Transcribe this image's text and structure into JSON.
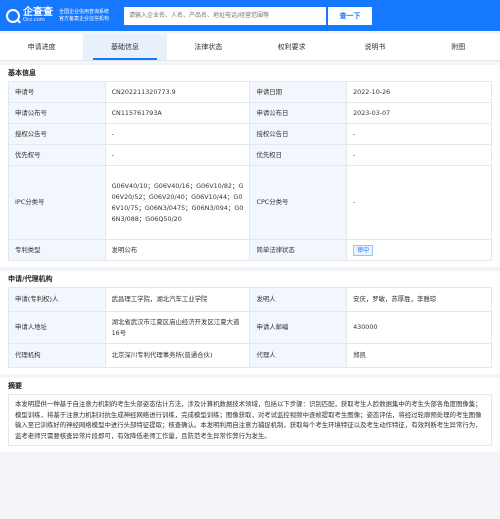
{
  "header": {
    "logo_name": "企查查",
    "logo_domain": "Qcc.com",
    "tagline_1": "全国企业信用查询系统",
    "tagline_2": "官方备案企业征信机构",
    "search_placeholder": "请输入企业名、人名、产品名、地址电话/经营范围等",
    "search_button": "查一下"
  },
  "tabs": [
    "申请进度",
    "基础信息",
    "法律状态",
    "权利要求",
    "说明书",
    "附图"
  ],
  "active_tab": 1,
  "basic": {
    "title": "基本信息",
    "rows": [
      {
        "l1": "申请号",
        "v1": "CN202211320773.9",
        "l2": "申请日期",
        "v2": "2022-10-26"
      },
      {
        "l1": "申请公布号",
        "v1": "CN115761793A",
        "l2": "申请公布日",
        "v2": "2023-03-07"
      },
      {
        "l1": "授权公告号",
        "v1": "-",
        "l2": "授权公告日",
        "v2": "-"
      },
      {
        "l1": "优先权号",
        "v1": "-",
        "l2": "优先权日",
        "v2": "-"
      },
      {
        "l1": "IPC分类号",
        "v1": "G06V40/10；G06V40/16；G06V10/82；G06V20/52；G06V20/40；G06V10/44；G06V10/75；G06N3/0475；G06N3/094；G06N3/088；G06Q50/20",
        "l2": "CPC分类号",
        "v2": "-"
      },
      {
        "l1": "专利类型",
        "v1": "发明公布",
        "l2": "简单法律状态",
        "v2": "审中"
      }
    ]
  },
  "applicant": {
    "title": "申请/代理机构",
    "applicant_label": "申请(专利权)人",
    "applicant_value": "武昌理工学院，湖北汽车工业学院",
    "inventor_label": "发明人",
    "inventor_value": "安庆，罗敏，苏厚胜，李雅琼",
    "address_label": "申请人地址",
    "address_value": "湖北省武汉市江夏区庙山经济开发区江夏大道16号",
    "postcode_label": "申请人邮编",
    "postcode_value": "430000",
    "agency_label": "代理机构",
    "agency_value": "北京深川专利代理事务所(普通合伙)",
    "agent_label": "代理人",
    "agent_value": "郑凯"
  },
  "abstract": {
    "title": "摘要",
    "text": "本发明提供一种基于自注意力机制的考生头部姿态估计方法，涉及计算机数据技术领域，包括以下步骤：识别匹配，获取考生人脸数据集中的考生头部各角度图像集；模型训练，将基于注意力机制对抗生成神经网络进行训练，完成模型训练；图像获取，对考试监控视频中逐帧提取考生图像；姿态评估，将经过轮廓预处理的考生图像输入至已训练好的神经网络模型中进行头部特征提取；核查确认。本发明利用自注意力捕捉机制，获取每个考生环境特征以及考生动作特征，有效判断考生异常行为，监考老师只需要核查异常片段即可，有效降低老师工作量，且防范考生异常作弊行为发生。"
  }
}
